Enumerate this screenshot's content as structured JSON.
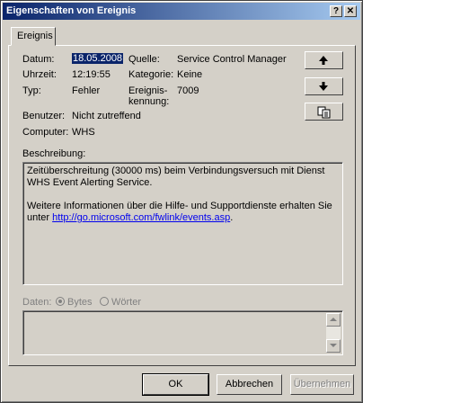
{
  "window": {
    "title": "Eigenschaften von Ereignis",
    "help_label": "?",
    "close_label": "✕"
  },
  "tabs": [
    {
      "label": "Ereignis"
    }
  ],
  "fields": {
    "datum_label": "Datum:",
    "datum_value": "18.05.2008",
    "quelle_label": "Quelle:",
    "quelle_value": "Service Control Manager",
    "uhrzeit_label": "Uhrzeit:",
    "uhrzeit_value": "12:19:55",
    "kategorie_label": "Kategorie:",
    "kategorie_value": "Keine",
    "typ_label": "Typ:",
    "typ_value": "Fehler",
    "kennung_label_1": "Ereignis-",
    "kennung_label_2": "kennung:",
    "kennung_value": "7009",
    "benutzer_label": "Benutzer:",
    "benutzer_value": "Nicht zutreffend",
    "computer_label": "Computer:",
    "computer_value": "WHS"
  },
  "side_buttons": {
    "up_icon": "arrow-up-icon",
    "down_icon": "arrow-down-icon",
    "copy_icon": "copy-icon"
  },
  "description": {
    "label": "Beschreibung:",
    "line1": "Zeitüberschreitung (30000 ms) beim Verbindungsversuch mit Dienst WHS Event Alerting Service.",
    "line2": "Weitere Informationen über die Hilfe- und Supportdienste erhalten Sie unter ",
    "link": "http://go.microsoft.com/fwlink/events.asp",
    "link_suffix": "."
  },
  "data_section": {
    "label": "Daten:",
    "bytes_label": "Bytes",
    "words_label": "Wörter",
    "selected": "bytes"
  },
  "buttons": {
    "ok": "OK",
    "cancel": "Abbrechen",
    "apply": "Übernehmen"
  }
}
